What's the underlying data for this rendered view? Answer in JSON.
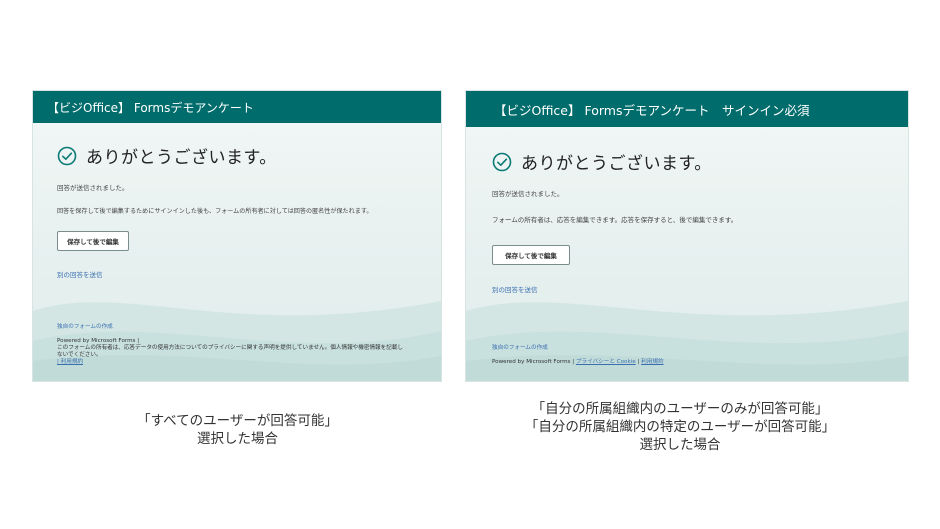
{
  "left_panel": {
    "header_title": "【ビジOffice】 Formsデモアンケート",
    "heading": "ありがとうございます。",
    "sent_message": "回答が送信されました。",
    "info_text": "回答を保存して後で編集するためにサインインした後も、フォームの所有者に対しては回答の匿名性が保たれます。",
    "save_button": "保存して後で編集",
    "another_response": "別の回答を送信",
    "create_form": "独自のフォームの作成",
    "powered_by": "Powered by Microsoft Forms |",
    "disclaimer_line1": "このフォームの所有者は、応答データの使用方法についてのプライバシーに関する声明を提供していません。個人情報や機密情報を記載し",
    "disclaimer_line2": "ないでください。",
    "terms": "| 利用規約"
  },
  "right_panel": {
    "header_title": "【ビジOffice】 Formsデモアンケート　サインイン必須",
    "heading": "ありがとうございます。",
    "sent_message": "回答が送信されました。",
    "info_text": "フォームの所有者は、応答を編集できます。応答を保存すると、後で編集できます。",
    "save_button": "保存して後で編集",
    "another_response": "別の回答を送信",
    "create_form": "独自のフォームの作成",
    "powered_by": "Powered by Microsoft Forms |",
    "privacy_link": "プライバシーと Cookie",
    "separator": "|",
    "terms": "利用規約"
  },
  "captions": {
    "left_line1": "「すべてのユーザーが回答可能」",
    "left_line2": "選択した場合",
    "right_line1": "「自分の所属組織内のユーザーのみが回答可能」",
    "right_line2": "「自分の所属組織内の特定のユーザーが回答可能」",
    "right_line3": "選択した場合"
  },
  "colors": {
    "header": "#006c6c",
    "accent": "#0b7a75",
    "link": "#3b6fb0"
  },
  "icons": {
    "success": "check-circle-icon"
  }
}
